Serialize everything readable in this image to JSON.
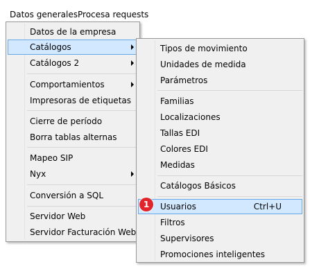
{
  "menubar": {
    "items": [
      {
        "label": "Datos generales"
      },
      {
        "label": "Procesa requests"
      }
    ]
  },
  "main_menu": {
    "items": [
      {
        "label": "Datos de la empresa"
      },
      {
        "label": "Catálogos",
        "has_submenu": true,
        "highlighted": true
      },
      {
        "label": "Catálogos 2",
        "has_submenu": true
      },
      {
        "label": "Comportamientos",
        "has_submenu": true
      },
      {
        "label": "Impresoras de etiquetas"
      },
      {
        "label": "Cierre de período"
      },
      {
        "label": "Borra tablas alternas"
      },
      {
        "label": "Mapeo SIP"
      },
      {
        "label": "Nyx",
        "has_submenu": true
      },
      {
        "label": "Conversión a SQL"
      },
      {
        "label": "Servidor Web"
      },
      {
        "label": "Servidor Facturación Web"
      }
    ]
  },
  "sub_menu": {
    "items": [
      {
        "label": "Tipos de movimiento"
      },
      {
        "label": "Unidades de medida"
      },
      {
        "label": "Parámetros"
      },
      {
        "label": "Familias"
      },
      {
        "label": "Localizaciones"
      },
      {
        "label": "Tallas EDI"
      },
      {
        "label": "Colores EDI"
      },
      {
        "label": "Medidas"
      },
      {
        "label": "Catálogos Básicos"
      },
      {
        "label": "Usuarios",
        "shortcut": "Ctrl+U",
        "highlighted": true
      },
      {
        "label": "Filtros"
      },
      {
        "label": "Supervisores"
      },
      {
        "label": "Promociones inteligentes"
      }
    ]
  },
  "callout": {
    "number": "1"
  },
  "colors": {
    "highlight_fill": "#d1e8ff",
    "highlight_border": "#66a7e8",
    "menu_background": "#f0f0f0",
    "callout": "#e0262c"
  }
}
